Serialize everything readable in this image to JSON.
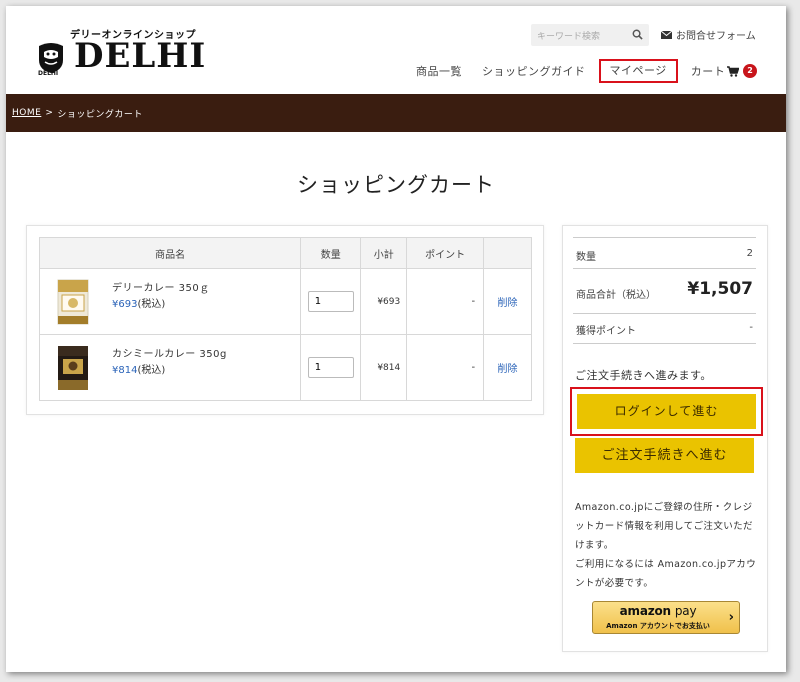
{
  "header": {
    "logo_sub": "デリーオンラインショップ",
    "logo_text": "DELHI",
    "logo_small": "DELHI",
    "search_placeholder": "キーワード検索",
    "contact_label": "お問合せフォーム"
  },
  "nav": {
    "items": [
      "商品一覧",
      "ショッピングガイド",
      "マイページ",
      "カート"
    ],
    "cart_count": "2"
  },
  "breadcrumb": {
    "home": "HOME",
    "separator": ">",
    "current": "ショッピングカート"
  },
  "page_title": "ショッピングカート",
  "cart": {
    "headers": [
      "商品名",
      "数量",
      "小計",
      "ポイント",
      ""
    ],
    "rows": [
      {
        "name": "デリーカレー 350ｇ",
        "price": "¥693",
        "tax": "(税込)",
        "qty": "1",
        "subtotal": "¥693",
        "points": "-",
        "delete": "削除"
      },
      {
        "name": "カシミールカレー 350g",
        "price": "¥814",
        "tax": "(税込)",
        "qty": "1",
        "subtotal": "¥814",
        "points": "-",
        "delete": "削除"
      }
    ]
  },
  "summary": {
    "qty_label": "数量",
    "qty_value": "2",
    "total_label": "商品合計（税込）",
    "total_value": "¥1,507",
    "points_label": "獲得ポイント",
    "points_value": "-",
    "proceed_note": "ご注文手続きへ進みます。",
    "login_button": "ログインして進む",
    "checkout_button": "ご注文手続きへ進む",
    "amazon_text_1": "Amazon.co.jpにご登録の住所・クレジットカード情報を利用してご注文いただけます。",
    "amazon_text_2": "ご利用になるには Amazon.co.jpアカウントが必要です。",
    "amazon_logo": "amazon",
    "amazon_pay": "pay",
    "amazon_sub": "Amazon アカウントでお支払い"
  },
  "colors": {
    "brown_bar": "#3a1d10",
    "accent_yellow": "#eac300",
    "highlight_red": "#d9111b",
    "link_blue": "#2a63b8"
  }
}
